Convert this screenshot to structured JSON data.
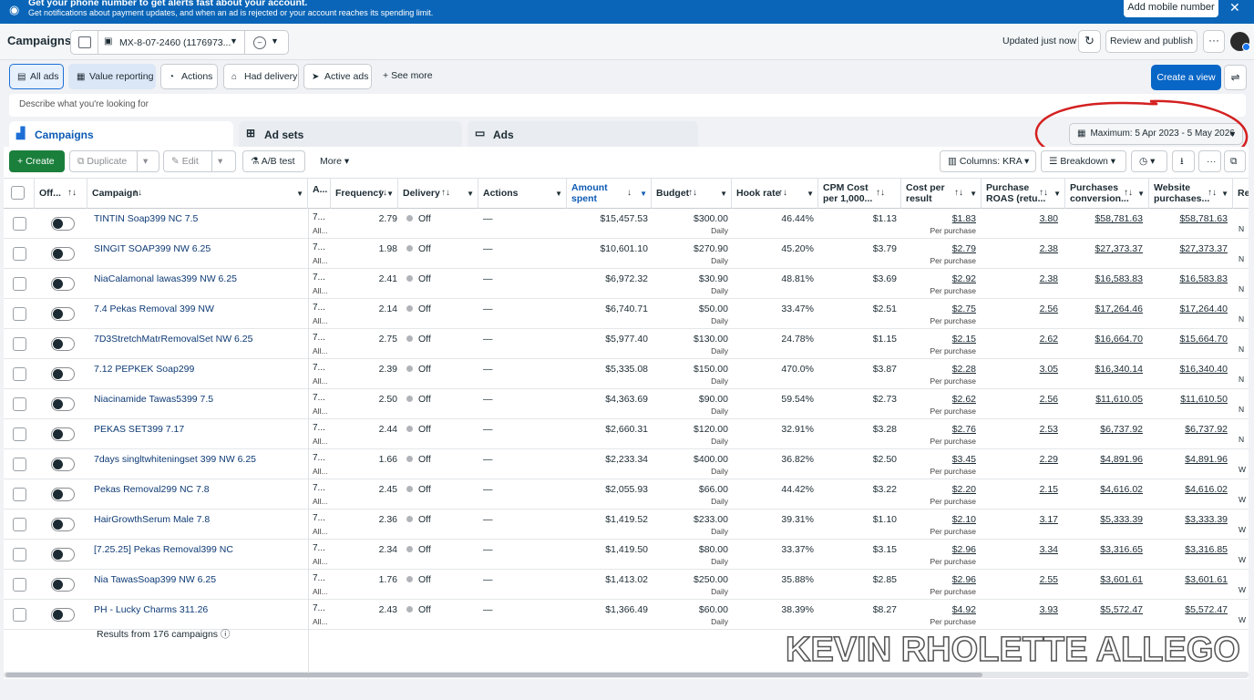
{
  "banner": {
    "line1": "Get your phone number to get alerts fast about your account.",
    "line2": "Get notifications about payment updates, and when an ad is rejected or your account reaches its spending limit.",
    "add_mobile": "Add mobile number",
    "close": "✕"
  },
  "header": {
    "title": "Campaigns",
    "account": "MX-8-07-2460 (1176973...",
    "updated": "Updated just now",
    "review_publish": "Review and publish",
    "more": "···"
  },
  "filters": {
    "all_ads": "All ads",
    "value_reporting": "Value reporting",
    "actions": "Actions",
    "had_delivery": "Had delivery",
    "active_ads": "Active ads",
    "see_more": "See more",
    "create_view": "Create a view"
  },
  "search": {
    "placeholder": "Describe what you're looking for"
  },
  "tabs": {
    "campaigns": "Campaigns",
    "ad_sets": "Ad sets",
    "ads": "Ads"
  },
  "date_range": "Maximum: 5 Apr 2023 - 5 May 2026",
  "toolbar": {
    "create": "Create",
    "duplicate": "Duplicate",
    "edit": "Edit",
    "ab_test": "A/B test",
    "more": "More",
    "columns": "Columns: KRA",
    "breakdown": "Breakdown"
  },
  "columns": {
    "off": "Off...",
    "campaign": "Campaign",
    "attr": "A...",
    "frequency": "Frequency",
    "delivery": "Delivery",
    "actions": "Actions",
    "amount_spent_1": "Amount",
    "amount_spent_2": "spent",
    "budget": "Budget",
    "hook_rate": "Hook rate",
    "cpm_1": "CPM Cost",
    "cpm_2": "per 1,000...",
    "cpr_1": "Cost per",
    "cpr_2": "result",
    "roas_1": "Purchase",
    "roas_2": "ROAS (retu...",
    "pcv_1": "Purchases",
    "pcv_2": "conversion...",
    "wp_1": "Website",
    "wp_2": "purchases...",
    "re": "Re"
  },
  "rows": [
    {
      "name": "TINTIN Soap399 NC 7.5",
      "attr": "7...",
      "attr2": "All...",
      "frequency": "2.79",
      "delivery": "Off",
      "actions": "—",
      "spent": "$15,457.53",
      "budget": "$300.00",
      "budget_period": "Daily",
      "hook_rate": "46.44%",
      "cpm": "$1.13",
      "cpr": "$1.83",
      "cpr_sub": "Per purchase",
      "roas": "3.80",
      "pcv": "$58,781.63",
      "wp": "$58,781.63",
      "re": "N"
    },
    {
      "name": "SINGIT SOAP399 NW 6.25",
      "attr": "7...",
      "attr2": "All...",
      "frequency": "1.98",
      "delivery": "Off",
      "actions": "—",
      "spent": "$10,601.10",
      "budget": "$270.90",
      "budget_period": "Daily",
      "hook_rate": "45.20%",
      "cpm": "$3.79",
      "cpr": "$2.79",
      "cpr_sub": "Per purchase",
      "roas": "2.38",
      "pcv": "$27,373.37",
      "wp": "$27,373.37",
      "re": "N"
    },
    {
      "name": "NiaCalamonal lawas399 NW 6.25",
      "attr": "7...",
      "attr2": "All...",
      "frequency": "2.41",
      "delivery": "Off",
      "actions": "—",
      "spent": "$6,972.32",
      "budget": "$30.90",
      "budget_period": "Daily",
      "hook_rate": "48.81%",
      "cpm": "$3.69",
      "cpr": "$2.92",
      "cpr_sub": "Per purchase",
      "roas": "2.38",
      "pcv": "$16,583.83",
      "wp": "$16,583.83",
      "re": "N"
    },
    {
      "name": "7.4 Pekas Removal 399 NW",
      "attr": "7...",
      "attr2": "All...",
      "frequency": "2.14",
      "delivery": "Off",
      "actions": "—",
      "spent": "$6,740.71",
      "budget": "$50.00",
      "budget_period": "Daily",
      "hook_rate": "33.47%",
      "cpm": "$2.51",
      "cpr": "$2.75",
      "cpr_sub": "Per purchase",
      "roas": "2.56",
      "pcv": "$17,264.46",
      "wp": "$17,264.40",
      "re": "N"
    },
    {
      "name": "7D3StretchMatrRemovalSet NW 6.25",
      "attr": "7...",
      "attr2": "All...",
      "frequency": "2.75",
      "delivery": "Off",
      "actions": "—",
      "spent": "$5,977.40",
      "budget": "$130.00",
      "budget_period": "Daily",
      "hook_rate": "24.78%",
      "cpm": "$1.15",
      "cpr": "$2.15",
      "cpr_sub": "Per purchase",
      "roas": "2.62",
      "pcv": "$16,664.70",
      "wp": "$15,664.70",
      "re": "N"
    },
    {
      "name": "7.12 PEPKEK Soap299",
      "attr": "7...",
      "attr2": "All...",
      "frequency": "2.39",
      "delivery": "Off",
      "actions": "—",
      "spent": "$5,335.08",
      "budget": "$150.00",
      "budget_period": "Daily",
      "hook_rate": "470.0%",
      "cpm": "$3.87",
      "cpr": "$2.28",
      "cpr_sub": "Per purchase",
      "roas": "3.05",
      "pcv": "$16,340.14",
      "wp": "$16,340.40",
      "re": "N"
    },
    {
      "name": "Niacinamide Tawas5399 7.5",
      "attr": "7...",
      "attr2": "All...",
      "frequency": "2.50",
      "delivery": "Off",
      "actions": "—",
      "spent": "$4,363.69",
      "budget": "$90.00",
      "budget_period": "Daily",
      "hook_rate": "59.54%",
      "cpm": "$2.73",
      "cpr": "$2.62",
      "cpr_sub": "Per purchase",
      "roas": "2.56",
      "pcv": "$11,610.05",
      "wp": "$11,610.50",
      "re": "N"
    },
    {
      "name": "PEKAS SET399 7.17",
      "attr": "7...",
      "attr2": "All...",
      "frequency": "2.44",
      "delivery": "Off",
      "actions": "—",
      "spent": "$2,660.31",
      "budget": "$120.00",
      "budget_period": "Daily",
      "hook_rate": "32.91%",
      "cpm": "$3.28",
      "cpr": "$2.76",
      "cpr_sub": "Per purchase",
      "roas": "2.53",
      "pcv": "$6,737.92",
      "wp": "$6,737.92",
      "re": "N"
    },
    {
      "name": "7days singltwhiteningset 399 NW 6.25",
      "attr": "7...",
      "attr2": "All...",
      "frequency": "1.66",
      "delivery": "Off",
      "actions": "—",
      "spent": "$2,233.34",
      "budget": "$400.00",
      "budget_period": "Daily",
      "hook_rate": "36.82%",
      "cpm": "$2.50",
      "cpr": "$3.45",
      "cpr_sub": "Per purchase",
      "roas": "2.29",
      "pcv": "$4,891.96",
      "wp": "$4,891.96",
      "re": "W"
    },
    {
      "name": "Pekas Removal299 NC 7.8",
      "attr": "7...",
      "attr2": "All...",
      "frequency": "2.45",
      "delivery": "Off",
      "actions": "—",
      "spent": "$2,055.93",
      "budget": "$66.00",
      "budget_period": "Daily",
      "hook_rate": "44.42%",
      "cpm": "$3.22",
      "cpr": "$2.20",
      "cpr_sub": "Per purchase",
      "roas": "2.15",
      "pcv": "$4,616.02",
      "wp": "$4,616.02",
      "re": "W"
    },
    {
      "name": "HairGrowthSerum Male 7.8",
      "attr": "7...",
      "attr2": "All...",
      "frequency": "2.36",
      "delivery": "Off",
      "actions": "—",
      "spent": "$1,419.52",
      "budget": "$233.00",
      "budget_period": "Daily",
      "hook_rate": "39.31%",
      "cpm": "$1.10",
      "cpr": "$2.10",
      "cpr_sub": "Per purchase",
      "roas": "3.17",
      "pcv": "$5,333.39",
      "wp": "$3,333.39",
      "re": "W"
    },
    {
      "name": "[7.25.25] Pekas Removal399 NC",
      "attr": "7...",
      "attr2": "All...",
      "frequency": "2.34",
      "delivery": "Off",
      "actions": "—",
      "spent": "$1,419.50",
      "budget": "$80.00",
      "budget_period": "Daily",
      "hook_rate": "33.37%",
      "cpm": "$3.15",
      "cpr": "$2.96",
      "cpr_sub": "Per purchase",
      "roas": "3.34",
      "pcv": "$3,316.65",
      "wp": "$3,316.85",
      "re": "W"
    },
    {
      "name": "Nia TawasSoap399 NW 6.25",
      "attr": "7...",
      "attr2": "All...",
      "frequency": "1.76",
      "delivery": "Off",
      "actions": "—",
      "spent": "$1,413.02",
      "budget": "$250.00",
      "budget_period": "Daily",
      "hook_rate": "35.88%",
      "cpm": "$2.85",
      "cpr": "$2.96",
      "cpr_sub": "Per purchase",
      "roas": "2.55",
      "pcv": "$3,601.61",
      "wp": "$3,601.61",
      "re": "W"
    },
    {
      "name": "PH - Lucky Charms 311.26",
      "attr": "7...",
      "attr2": "All...",
      "frequency": "2.43",
      "delivery": "Off",
      "actions": "—",
      "spent": "$1,366.49",
      "budget": "$60.00",
      "budget_period": "Daily",
      "hook_rate": "38.39%",
      "cpm": "$8.27",
      "cpr": "$4.92",
      "cpr_sub": "Per purchase",
      "roas": "3.93",
      "pcv": "$5,572.47",
      "wp": "$5,572.47",
      "re": "W"
    }
  ],
  "footer": "Results from 176 campaigns",
  "watermark": "KEVIN RHOLETTE ALLEGO"
}
